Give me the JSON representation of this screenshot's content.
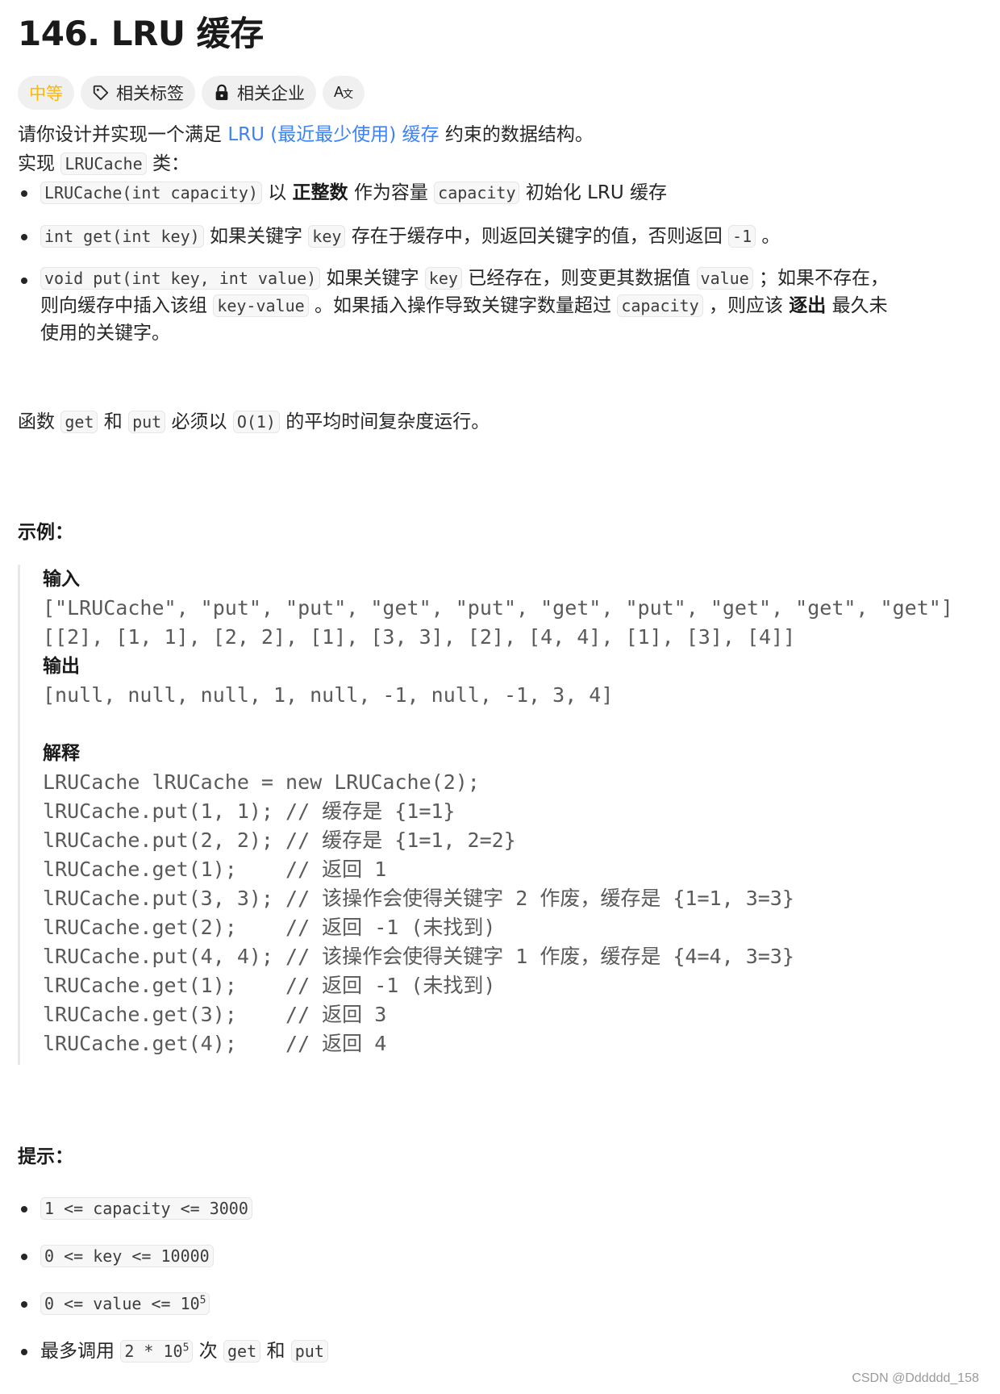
{
  "header": {
    "title": "146. LRU 缓存",
    "tags": {
      "difficulty": "中等",
      "difficulty_color": "#ffb800",
      "related_tags": "相关标签",
      "related_tags_icon": "tag-icon",
      "related_companies": "相关企业",
      "related_companies_icon": "lock-icon",
      "translate": "Aẋ",
      "translate_icon": "translate-icon"
    }
  },
  "description": {
    "intro_prefix": "请你设计并实现一个满足 ",
    "intro_link": "LRU (最近最少使用) 缓存",
    "intro_suffix": " 约束的数据结构。",
    "impl_prefix": "实现 ",
    "impl_code": "LRUCache",
    "impl_suffix": " 类：",
    "bullets": [
      {
        "code1": "LRUCache(int capacity)",
        "t1": " 以 ",
        "bold1": "正整数",
        "t2": " 作为容量 ",
        "code2": "capacity",
        "t3": " 初始化 LRU 缓存"
      },
      {
        "code1": "int get(int key)",
        "t1": " 如果关键字 ",
        "code2": "key",
        "t2": " 存在于缓存中，则返回关键字的值，否则返回 ",
        "code3": "-1",
        "t3": " 。"
      },
      {
        "code1": "void put(int key, int value)",
        "t1": " 如果关键字 ",
        "code2": "key",
        "t2": " 已经存在，则变更其数据值 ",
        "code3": "value",
        "t3": " ；如果不存在，",
        "line2_t1": "则向缓存中插入该组 ",
        "code4": "key-value",
        "line2_t2": " 。如果插入操作导致关键字数量超过 ",
        "code5": "capacity",
        "line2_t3": " ，则应该 ",
        "bold1": "逐出",
        "line2_t4": " 最久未",
        "line3": "使用的关键字。"
      }
    ],
    "complexity": {
      "t1": "函数 ",
      "code1": "get",
      "t2": " 和 ",
      "code2": "put",
      "t3": " 必须以 ",
      "code3": "O(1)",
      "t4": " 的平均时间复杂度运行。"
    }
  },
  "example": {
    "heading": "示例：",
    "input_label": "输入",
    "input_line1": "[\"LRUCache\", \"put\", \"put\", \"get\", \"put\", \"get\", \"put\", \"get\", \"get\", \"get\"]",
    "input_line2": "[[2], [1, 1], [2, 2], [1], [3, 3], [2], [4, 4], [1], [3], [4]]",
    "output_label": "输出",
    "output_line": "[null, null, null, 1, null, -1, null, -1, 3, 4]",
    "explain_label": "解释",
    "explain_lines": [
      "LRUCache lRUCache = new LRUCache(2);",
      "lRUCache.put(1, 1); // 缓存是 {1=1}",
      "lRUCache.put(2, 2); // 缓存是 {1=1, 2=2}",
      "lRUCache.get(1);    // 返回 1",
      "lRUCache.put(3, 3); // 该操作会使得关键字 2 作废，缓存是 {1=1, 3=3}",
      "lRUCache.get(2);    // 返回 -1 (未找到)",
      "lRUCache.put(4, 4); // 该操作会使得关键字 1 作废，缓存是 {4=4, 3=3}",
      "lRUCache.get(1);    // 返回 -1 (未找到)",
      "lRUCache.get(3);    // 返回 3",
      "lRUCache.get(4);    // 返回 4"
    ]
  },
  "constraints": {
    "heading": "提示：",
    "items": [
      {
        "code": "1 <= capacity <= 3000"
      },
      {
        "code": "0 <= key <= 10000"
      },
      {
        "code_base": "0 <= value <= 10",
        "code_sup": "5"
      },
      {
        "t1": "最多调用 ",
        "code_base": "2 * 10",
        "code_sup": "5",
        "t2": " 次 ",
        "code2": "get",
        "t3": " 和 ",
        "code3": "put"
      }
    ]
  },
  "watermark": "CSDN @Dddddd_158"
}
